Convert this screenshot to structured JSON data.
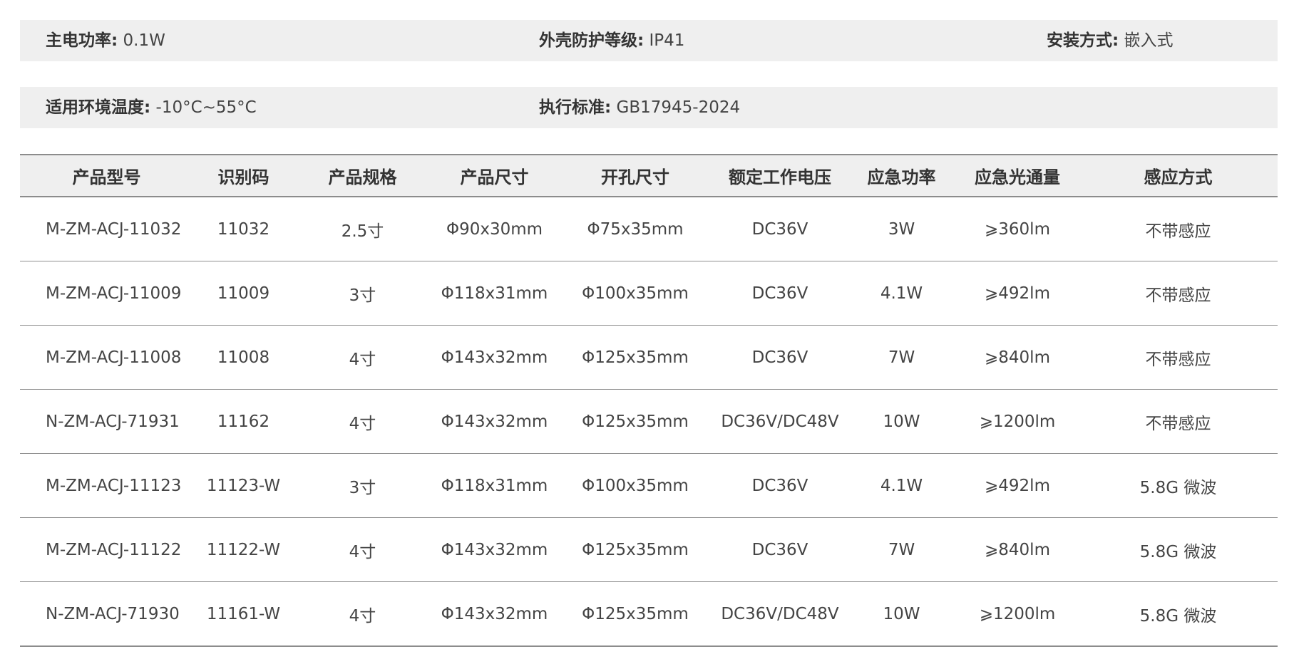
{
  "specs": {
    "main_power": {
      "label": "主电功率:",
      "value": "0.1W"
    },
    "protection": {
      "label": "外壳防护等级:",
      "value": "IP41"
    },
    "install": {
      "label": "安装方式:",
      "value": "嵌入式"
    },
    "temperature": {
      "label": "适用环境温度:",
      "value": "-10°C~55°C"
    },
    "standard": {
      "label": "执行标准:",
      "value": "GB17945-2024"
    }
  },
  "table": {
    "headers": [
      "产品型号",
      "识别码",
      "产品规格",
      "产品尺寸",
      "开孔尺寸",
      "额定工作电压",
      "应急功率",
      "应急光通量",
      "感应方式"
    ],
    "rows": [
      [
        "M-ZM-ACJ-11032",
        "11032",
        "2.5寸",
        "Φ90x30mm",
        "Φ75x35mm",
        "DC36V",
        "3W",
        "⩾360lm",
        "不带感应"
      ],
      [
        "M-ZM-ACJ-11009",
        "11009",
        "3寸",
        "Φ118x31mm",
        "Φ100x35mm",
        "DC36V",
        "4.1W",
        "⩾492lm",
        "不带感应"
      ],
      [
        "M-ZM-ACJ-11008",
        "11008",
        "4寸",
        "Φ143x32mm",
        "Φ125x35mm",
        "DC36V",
        "7W",
        "⩾840lm",
        "不带感应"
      ],
      [
        "N-ZM-ACJ-71931",
        "11162",
        "4寸",
        "Φ143x32mm",
        "Φ125x35mm",
        "DC36V/DC48V",
        "10W",
        "⩾1200lm",
        "不带感应"
      ],
      [
        "M-ZM-ACJ-11123",
        "11123-W",
        "3寸",
        "Φ118x31mm",
        "Φ100x35mm",
        "DC36V",
        "4.1W",
        "⩾492lm",
        "5.8G 微波"
      ],
      [
        "M-ZM-ACJ-11122",
        "11122-W",
        "4寸",
        "Φ143x32mm",
        "Φ125x35mm",
        "DC36V",
        "7W",
        "⩾840lm",
        "5.8G 微波"
      ],
      [
        "N-ZM-ACJ-71930",
        "11161-W",
        "4寸",
        "Φ143x32mm",
        "Φ125x35mm",
        "DC36V/DC48V",
        "10W",
        "⩾1200lm",
        "5.8G 微波"
      ]
    ]
  }
}
